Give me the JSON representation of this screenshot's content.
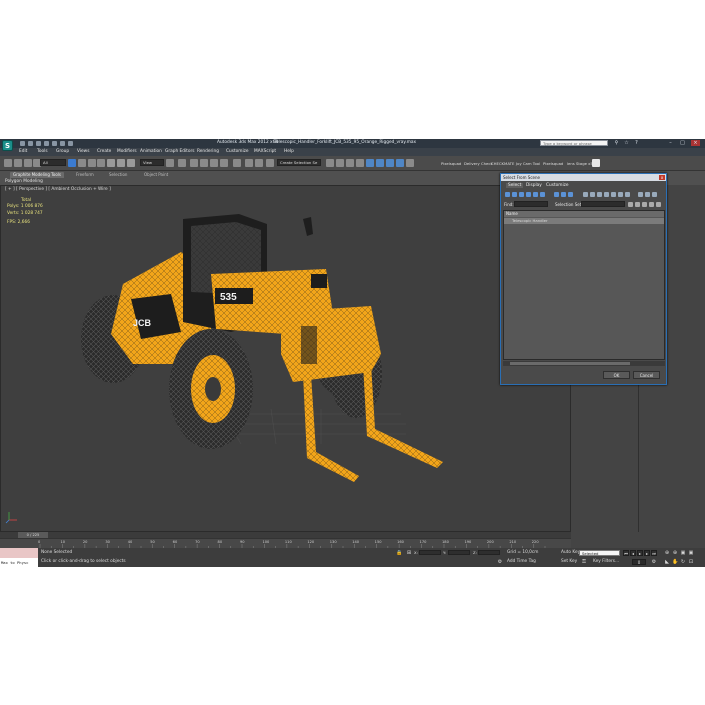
{
  "titlebar": {
    "app_name": "Autodesk 3ds Max 2012 x64",
    "file_name": "Telescopic_Handler_Forklift_JCB_535_95_Orange_Rigged_vray.max",
    "search_placeholder": "Type a keyword or phrase",
    "logo_text": "S"
  },
  "menubar": {
    "items": [
      "Edit",
      "Tools",
      "Group",
      "Views",
      "Create",
      "Modifiers",
      "Animation",
      "Graph Editors",
      "Rendering",
      "Customize",
      "MAXScript",
      "Help"
    ]
  },
  "toolbar": {
    "filter_value": "All",
    "view_value": "View",
    "selection_set_placeholder": "Create Selection Se",
    "tools": [
      "Pixelsquad",
      "Delivery Check",
      "CHECKMATE",
      "Joy Cam Tool",
      "Pixelsquad",
      "lens Stage x5"
    ]
  },
  "ribbon": {
    "tabs": [
      "Graphite Modeling Tools",
      "Freeform",
      "Selection",
      "Object Paint"
    ],
    "active_tab": "Graphite Modeling Tools",
    "sub_label": "Polygon Modeling"
  },
  "viewport": {
    "label": "[ + ] [ Perspective ] [ Ambient Occlusion + Wire ]",
    "stats_header": "Total",
    "polys_label": "Polys:",
    "polys_value": "1 006 876",
    "verts_label": "Verts:",
    "verts_value": "1 028 747",
    "fps_label": "FPS:",
    "fps_value": "2,666",
    "model_brand": "JCB",
    "model_number": "535"
  },
  "dialog": {
    "title": "Select From Scene",
    "close_label": "x",
    "menus": [
      "Select",
      "Display",
      "Customize"
    ],
    "find_label": "Find:",
    "selection_set_label": "Selection Set:",
    "column_header": "Name",
    "rows": [
      "Telescopic Handler"
    ],
    "ok_label": "OK",
    "cancel_label": "Cancel"
  },
  "timeline": {
    "slider_label": "0 / 225",
    "ticks": [
      "0",
      "10",
      "20",
      "30",
      "40",
      "50",
      "60",
      "70",
      "80",
      "90",
      "100",
      "110",
      "120",
      "130",
      "140",
      "150",
      "160",
      "170",
      "180",
      "190",
      "200",
      "210",
      "220"
    ]
  },
  "status": {
    "maxscript_text": "Max to Physc",
    "selection_text": "None Selected",
    "prompt_text": "Click or click-and-drag to select objects",
    "x_label": "X:",
    "y_label": "Y:",
    "z_label": "Z:",
    "grid_text": "Grid = 10,0cm",
    "add_time_tag": "Add Time Tag",
    "auto_key": "Auto Key",
    "set_key": "Set Key",
    "selected_value": "Selected",
    "key_filters": "Key Filters...",
    "frame_value": "0"
  },
  "colors": {
    "viewport_bg": "#3f3f3f",
    "model_yellow": "#f2a51a",
    "stats_yellow": "#e9e37e",
    "dialog_border": "#2a6fb5"
  }
}
